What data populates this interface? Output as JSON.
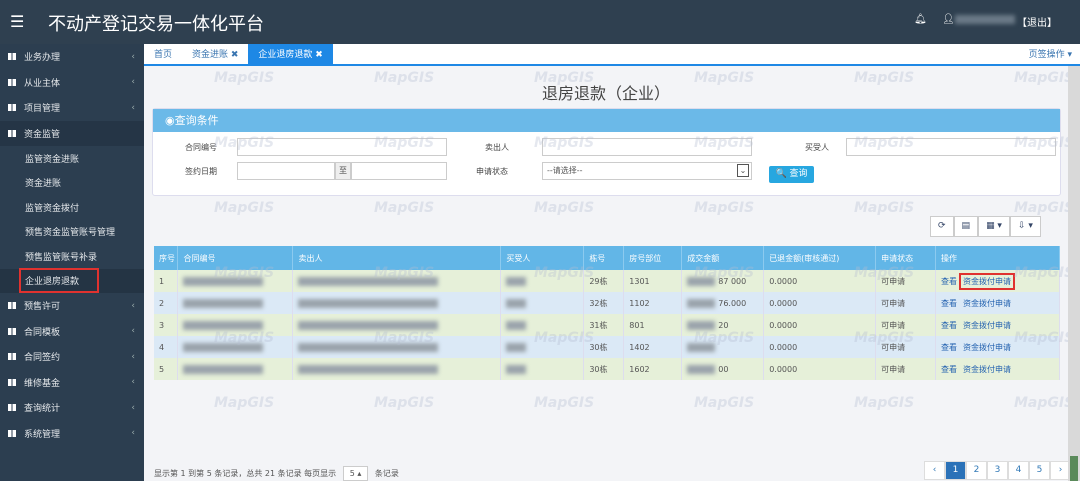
{
  "header": {
    "menu_icon": "☰",
    "title": "不动产登记交易一体化平台",
    "logout": "【退出】"
  },
  "sidebar": {
    "items": [
      {
        "label": "业务办理"
      },
      {
        "label": "从业主体"
      },
      {
        "label": "项目管理"
      },
      {
        "label": "资金监管",
        "active": true,
        "children": [
          "监管资金进账",
          "资金进账",
          "监管资金拨付",
          "预售资金监管账号管理",
          "预售监管账号补录",
          "企业退房退款"
        ]
      },
      {
        "label": "预售许可"
      },
      {
        "label": "合同模板"
      },
      {
        "label": "合同签约"
      },
      {
        "label": "维修基金"
      },
      {
        "label": "查询统计"
      },
      {
        "label": "系统管理"
      }
    ]
  },
  "tabs": [
    {
      "label": "首页"
    },
    {
      "label": "资金进账 ✖"
    },
    {
      "label": "企业退房退款 ✖",
      "active": true
    }
  ],
  "page_ops": "页签操作 ▾",
  "page_title": "退房退款（企业）",
  "query": {
    "title": "◉查询条件",
    "contract_no": "合同编号",
    "seller": "卖出人",
    "buyer": "买受人",
    "sign_date": "签约日期",
    "to": "至",
    "status": "申请状态",
    "status_placeholder": "--请选择--",
    "search": "🔍 查询"
  },
  "toolbar": {
    "refresh": "⟳",
    "list": "▤",
    "columns": "▦ ▾",
    "export": "⇩ ▾"
  },
  "table": {
    "headers": [
      "序号",
      "合同编号",
      "卖出人",
      "买受人",
      "栋号",
      "房号部位",
      "成交金额",
      "已退金额(审核通过)",
      "申请状态",
      "操作"
    ],
    "rows": [
      {
        "no": "1",
        "building": "29栋",
        "room": "1301",
        "amount": "87 000",
        "refunded": "0.0000",
        "status": "可申请"
      },
      {
        "no": "2",
        "building": "32栋",
        "room": "1102",
        "amount": "76.000",
        "refunded": "0.0000",
        "status": "可申请"
      },
      {
        "no": "3",
        "building": "31栋",
        "room": "801",
        "amount": "20",
        "refunded": "0.0000",
        "status": "可申请"
      },
      {
        "no": "4",
        "building": "30栋",
        "room": "1402",
        "amount": "",
        "refunded": "0.0000",
        "status": "可申请"
      },
      {
        "no": "5",
        "building": "30栋",
        "room": "1602",
        "amount": "00",
        "refunded": "0.0000",
        "status": "可申请"
      }
    ],
    "view": "查看",
    "apply": "资金拨付申请"
  },
  "footer": {
    "text1": "显示第 1 到第 5 条记录，总共 21 条记录 每页显示",
    "page_size": "5 ▴",
    "text2": "条记录"
  },
  "pager": [
    "‹",
    "1",
    "2",
    "3",
    "4",
    "5",
    "›"
  ],
  "pager_current": "1",
  "watermark": "MapGIS",
  "colors": {
    "topbar": "#2f4050",
    "sidebar": "#2c3e50",
    "accent": "#1e88e5",
    "table_header": "#62b6e7",
    "highlight": "#e0322f"
  }
}
